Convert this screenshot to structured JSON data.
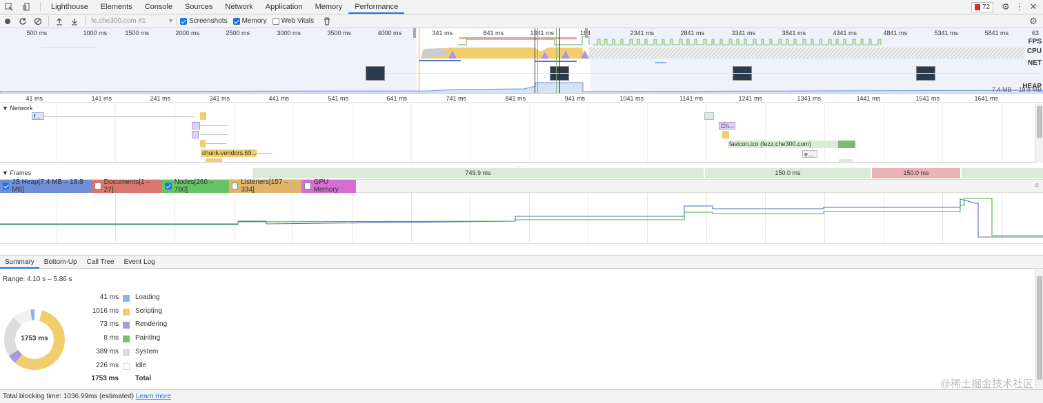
{
  "tabs": [
    {
      "label": "Lighthouse"
    },
    {
      "label": "Elements"
    },
    {
      "label": "Console"
    },
    {
      "label": "Sources"
    },
    {
      "label": "Network"
    },
    {
      "label": "Application"
    },
    {
      "label": "Memory"
    },
    {
      "label": "Performance"
    }
  ],
  "error_count": "72",
  "toolbar": {
    "session": "fe.che300.com #1",
    "screenshots_label": "Screenshots",
    "memory_label": "Memory",
    "webvitals_label": "Web Vitals"
  },
  "overview": {
    "ticks": [
      "500 ms",
      "1000 ms",
      "1500 ms",
      "2000 ms",
      "2500 ms",
      "3000 ms",
      "3500 ms",
      "4000 ms",
      "341 ms",
      "841 ms",
      "1341 ms",
      "184",
      "2341 ms",
      "2841 ms",
      "3341 ms",
      "3841 ms",
      "4341 ms",
      "4841 ms",
      "5341 ms",
      "5841 ms",
      "63"
    ],
    "fps": "FPS",
    "cpu": "CPU",
    "net": "NET",
    "heap": "HEAP",
    "heap_range": "7.4 MB – 18.8 MB"
  },
  "ruler": [
    "41 ms",
    "141 ms",
    "241 ms",
    "341 ms",
    "441 ms",
    "541 ms",
    "641 ms",
    "741 ms",
    "841 ms",
    "941 ms",
    "1041 ms",
    "1141 ms",
    "1241 ms",
    "1341 ms",
    "1441 ms",
    "1541 ms",
    "1641 ms"
  ],
  "network": {
    "title": "Network",
    "requests": [
      "f...",
      "chunk-vendors.69...",
      "Ch...",
      "favicon.ico (fezz.che300.com)",
      "e..."
    ]
  },
  "frames": {
    "title": "Frames",
    "bars": [
      "749.9 ms",
      "150.0 ms",
      "150.0 ms"
    ]
  },
  "counters": [
    {
      "label": "JS Heap[7.4 MB – 18.8 MB]",
      "checked": true,
      "color": "#6f8ed8"
    },
    {
      "label": "Documents[1 – 27]",
      "checked": false,
      "color": "#d9776c"
    },
    {
      "label": "Nodes[260 – 780]",
      "checked": true,
      "color": "#66c466"
    },
    {
      "label": "Listeners[157 – 334]",
      "checked": false,
      "color": "#e0b46a"
    },
    {
      "label": "GPU Memory",
      "checked": false,
      "color": "#d46ed4"
    }
  ],
  "detail_tabs": [
    "Summary",
    "Bottom-Up",
    "Call Tree",
    "Event Log"
  ],
  "summary": {
    "range": "Range: 4.10 s – 5.86 s",
    "total_center": "1753 ms",
    "rows": [
      {
        "value": "41 ms",
        "name": "Loading",
        "color": "#8ab4e8"
      },
      {
        "value": "1016 ms",
        "name": "Scripting",
        "color": "#f2cd6e"
      },
      {
        "value": "73 ms",
        "name": "Rendering",
        "color": "#ad95e6"
      },
      {
        "value": "8 ms",
        "name": "Painting",
        "color": "#7fb979"
      },
      {
        "value": "389 ms",
        "name": "System",
        "color": "#dcdcdc"
      },
      {
        "value": "226 ms",
        "name": "Idle",
        "color": "#ffffff"
      },
      {
        "value": "1753 ms",
        "name": "Total",
        "color": ""
      }
    ]
  },
  "footer": {
    "text": "Total blocking time: 1036.99ms (estimated)",
    "link": "Learn more"
  },
  "watermark": "@稀土掘金技术社区"
}
